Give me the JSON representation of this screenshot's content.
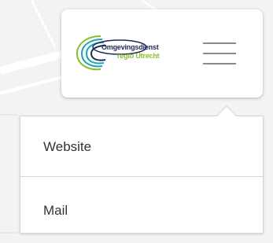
{
  "logo": {
    "line1": "Omgevingsdienst",
    "line2_prefix": "regio",
    "line2_suffix": "Utrecht",
    "colors": {
      "navy": "#1e2a55",
      "green": "#8bbd2a",
      "teal": "#1aa6b7"
    }
  },
  "menu_button": {
    "icon": "hamburger-menu-icon"
  },
  "dropdown": {
    "items": [
      {
        "label": "Website"
      },
      {
        "label": "Mail"
      }
    ]
  }
}
